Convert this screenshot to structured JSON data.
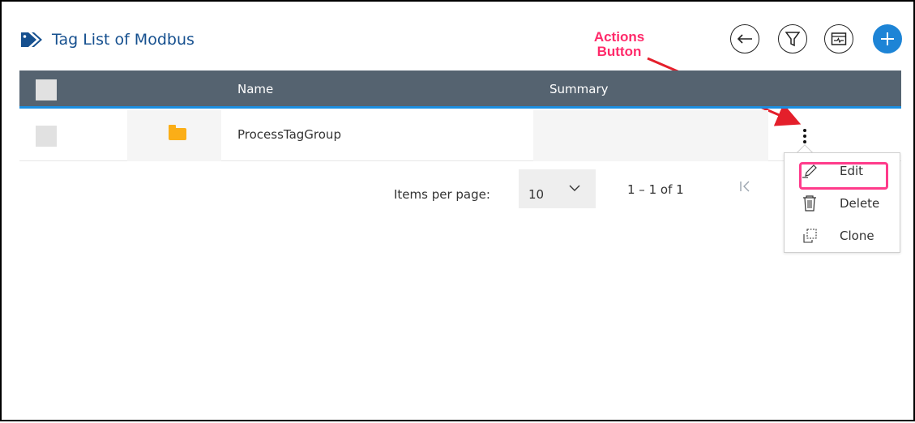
{
  "page": {
    "title": "Tag List of Modbus"
  },
  "header_actions": [
    {
      "name": "back",
      "icon": "arrow-left-icon"
    },
    {
      "name": "filter",
      "icon": "filter-icon"
    },
    {
      "name": "monitor",
      "icon": "monitor-icon"
    },
    {
      "name": "add",
      "icon": "plus-icon"
    }
  ],
  "annotation": {
    "line1": "Actions",
    "line2": "Button",
    "color": "#ff2a6a"
  },
  "table": {
    "columns": [
      "Name",
      "Summary"
    ],
    "rows": [
      {
        "icon": "folder-icon",
        "name": "ProcessTagGroup",
        "summary": ""
      }
    ]
  },
  "pagination": {
    "items_per_page_label": "Items per page:",
    "items_per_page_value": "10",
    "range": "1 – 1 of 1"
  },
  "actions_menu": [
    {
      "label": "Edit",
      "icon": "pencil-icon",
      "highlighted": true
    },
    {
      "label": "Delete",
      "icon": "trash-icon",
      "highlighted": false
    },
    {
      "label": "Clone",
      "icon": "clone-icon",
      "highlighted": false
    }
  ],
  "colors": {
    "title": "#16508f",
    "header_bar": "#556370",
    "header_underline": "#1b8ee0",
    "primary_button": "#1d84d6",
    "folder": "#fbae17",
    "highlight": "#ff3b8b"
  }
}
